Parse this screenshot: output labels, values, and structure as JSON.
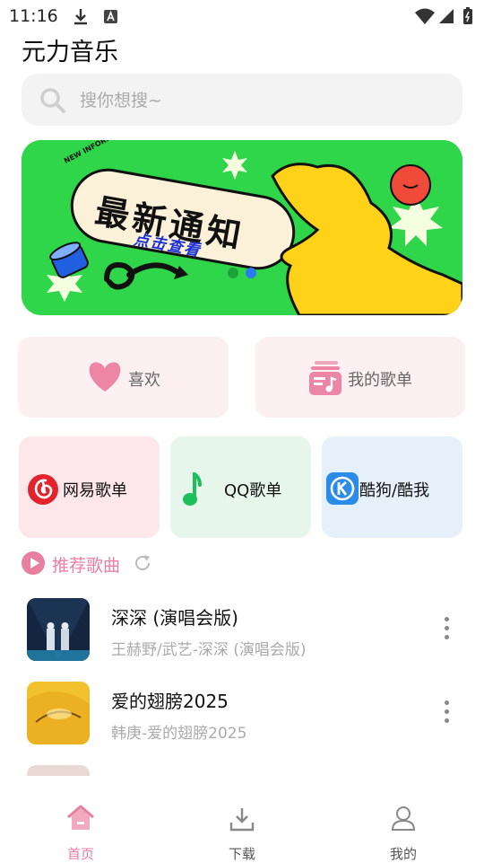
{
  "status_bar": {
    "time": "11:16"
  },
  "app": {
    "title": "元力音乐"
  },
  "search": {
    "placeholder": "搜你想搜~"
  },
  "banner": {
    "headline": "最新通知",
    "subline": "点击查看",
    "tag": "NEW INFORMARTION",
    "pages": 2,
    "active_page": 2
  },
  "quick": {
    "favorites_label": "喜欢",
    "my_playlists_label": "我的歌单"
  },
  "platforms": [
    {
      "label": "网易歌单",
      "icon": "netease-icon",
      "color": "#e2232b"
    },
    {
      "label": "QQ歌单",
      "icon": "qq-music-icon",
      "color": "#1fbf5c"
    },
    {
      "label": "酷狗/酷我",
      "icon": "kugou-icon",
      "color": "#2a8be8"
    }
  ],
  "section": {
    "title": "推荐歌曲"
  },
  "songs": [
    {
      "title": "深深 (演唱会版)",
      "subtitle": "王赫野/武艺-深深 (演唱会版)"
    },
    {
      "title": "爱的翅膀2025",
      "subtitle": "韩庚-爱的翅膀2025"
    }
  ],
  "nav": [
    {
      "label": "首页",
      "icon": "home-icon",
      "active": true
    },
    {
      "label": "下载",
      "icon": "download-icon",
      "active": false
    },
    {
      "label": "我的",
      "icon": "user-icon",
      "active": false
    }
  ],
  "colors": {
    "accent": "#e87fa0",
    "banner_green": "#2fd64a"
  }
}
